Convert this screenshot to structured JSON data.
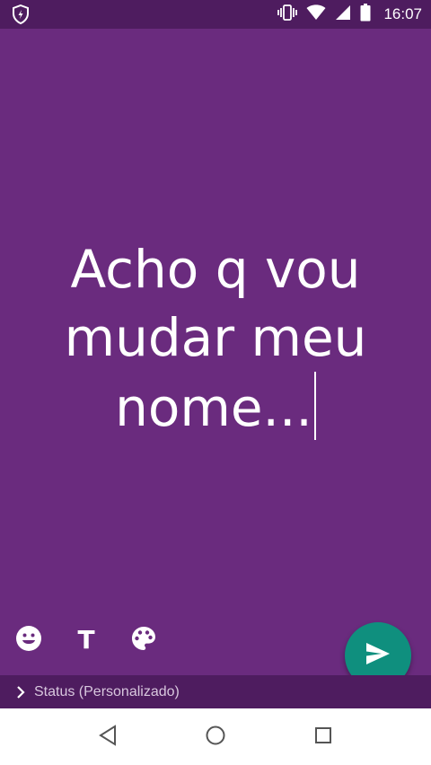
{
  "status_bar": {
    "time": "16:07",
    "icons": [
      "shield-icon",
      "vibrate-icon",
      "wifi-icon",
      "cellular-signal-icon",
      "battery-icon"
    ]
  },
  "composer": {
    "lines": [
      "Acho q vou",
      "mudar meu",
      "nome..."
    ],
    "background_color": "#6a2b7e",
    "text_color": "#ffffff"
  },
  "tools": {
    "emoji": "emoji-icon",
    "text_style_label": "T",
    "palette": "palette-icon"
  },
  "send_button": {
    "icon": "send-icon",
    "color": "#0f8f7e"
  },
  "audience": {
    "label": "Status (Personalizado)"
  },
  "navigation": {
    "buttons": [
      "back-icon",
      "home-icon",
      "recents-icon"
    ]
  }
}
